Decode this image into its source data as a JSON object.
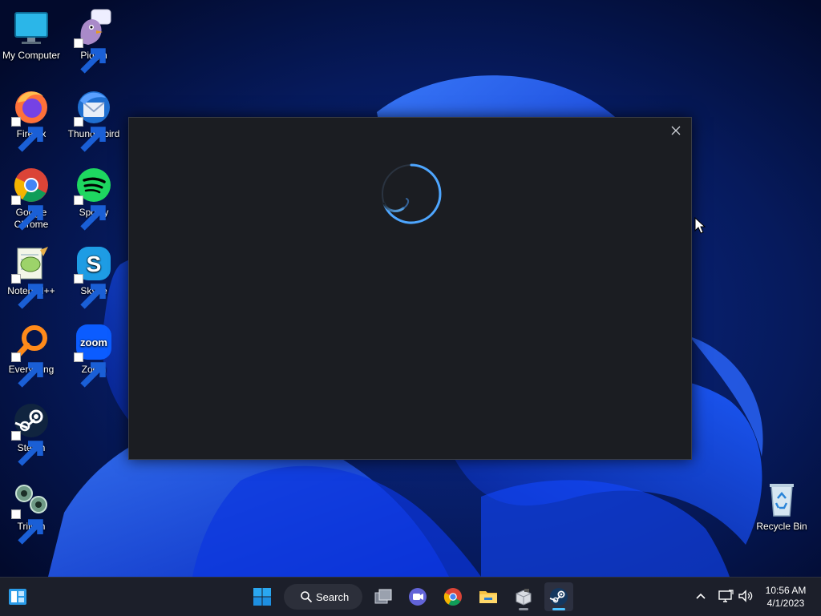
{
  "desktop": {
    "icons": [
      {
        "name": "my-computer-icon",
        "label": "My Computer",
        "shortcut": false
      },
      {
        "name": "pidgin-icon",
        "label": "Pidgin",
        "shortcut": true
      },
      {
        "name": "firefox-icon",
        "label": "Firefox",
        "shortcut": true
      },
      {
        "name": "thunderbird-icon",
        "label": "Thunderbird",
        "shortcut": true
      },
      {
        "name": "chrome-icon",
        "label": "Google Chrome",
        "shortcut": true
      },
      {
        "name": "spotify-icon",
        "label": "Spotify",
        "shortcut": true
      },
      {
        "name": "notepadpp-icon",
        "label": "Notepad++",
        "shortcut": true
      },
      {
        "name": "skype-icon",
        "label": "Skype",
        "shortcut": true
      },
      {
        "name": "everything-icon",
        "label": "Everything",
        "shortcut": true
      },
      {
        "name": "zoom-icon",
        "label": "Zoom",
        "shortcut": true
      },
      {
        "name": "steam-icon",
        "label": "Steam",
        "shortcut": true
      },
      {
        "name": "trillian-icon",
        "label": "Trillian",
        "shortcut": true
      },
      {
        "name": "recycle-bin-icon",
        "label": "Recycle Bin",
        "shortcut": false
      }
    ],
    "zoom_logo_text": "zoom",
    "skype_logo_text": "S"
  },
  "dialog": {
    "close_icon": "close-icon",
    "spinner_icon": "loading-spinner-icon",
    "background": "#1b1d22",
    "accent": "#4ea6ff"
  },
  "taskbar": {
    "search_label": "Search",
    "apps": [
      {
        "name": "taskbar-start",
        "icon": "windows-start-icon"
      },
      {
        "name": "taskbar-task-view",
        "icon": "task-view-icon"
      },
      {
        "name": "taskbar-chat",
        "icon": "chat-icon"
      },
      {
        "name": "taskbar-chrome",
        "icon": "chrome-icon"
      },
      {
        "name": "taskbar-file-explorer",
        "icon": "folder-icon"
      },
      {
        "name": "taskbar-app",
        "icon": "package-icon",
        "running": true
      },
      {
        "name": "taskbar-steam",
        "icon": "steam-icon",
        "active": true
      }
    ],
    "tray": {
      "overflow_icon": "chevron-up-icon",
      "network_icon": "network-icon",
      "volume_icon": "volume-icon"
    },
    "clock": {
      "time": "10:56 AM",
      "date": "4/1/2023"
    }
  },
  "colors": {
    "taskbar": "#1c1f2a",
    "wallpaper_dark": "#04113f",
    "wallpaper_bloom": "#1a4cff",
    "active_indicator": "#4cc2ff"
  }
}
